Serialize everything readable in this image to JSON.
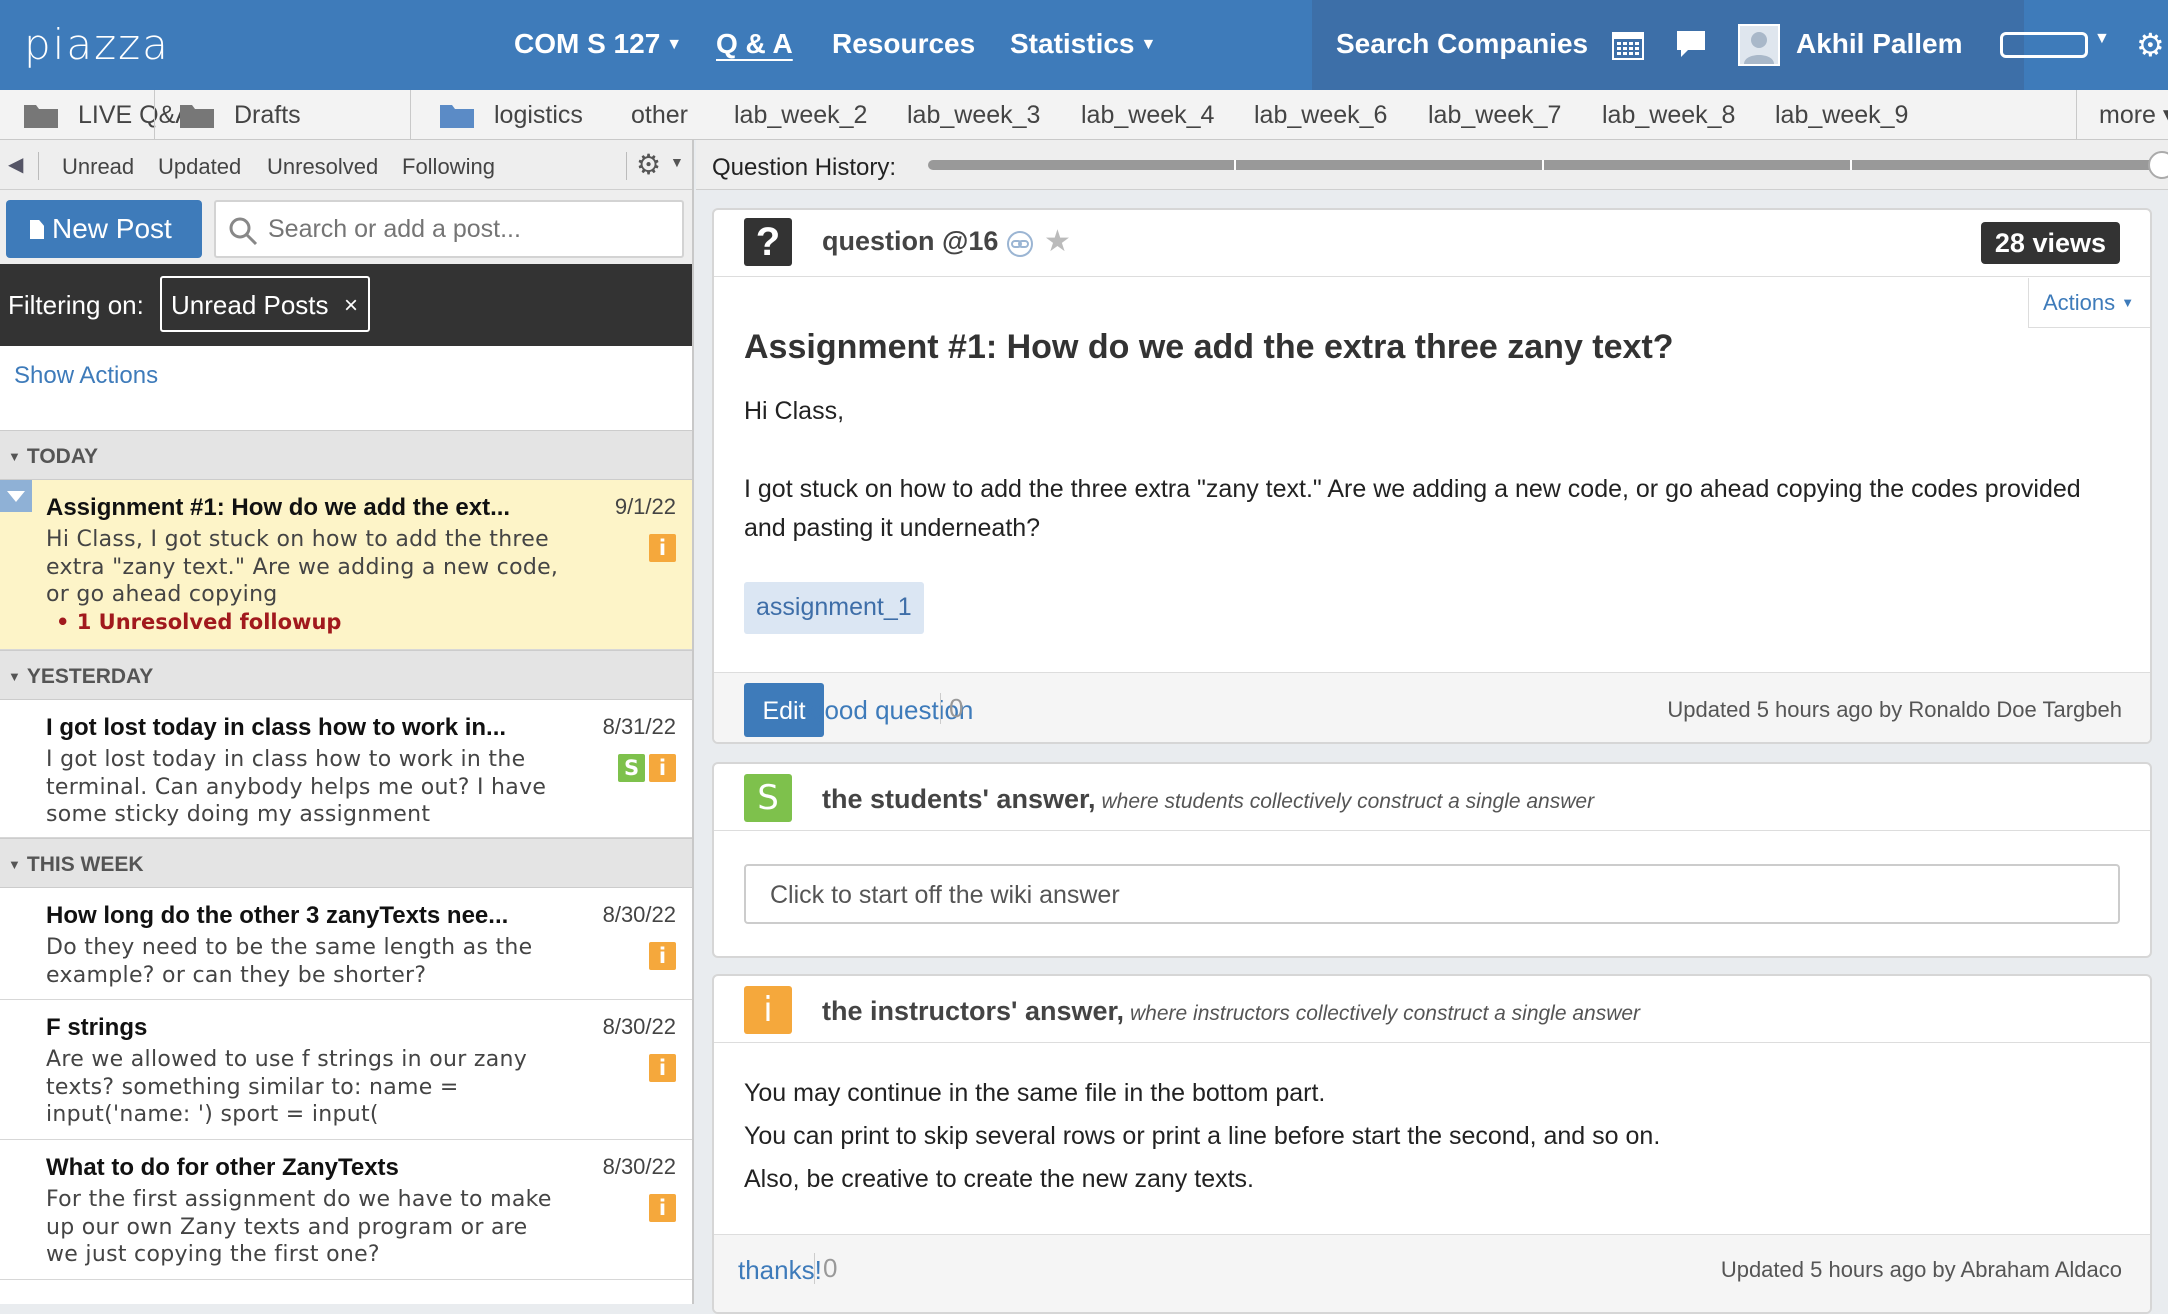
{
  "topbar": {
    "logo": "piazza",
    "course": "COM S 127",
    "qa": "Q & A",
    "resources": "Resources",
    "statistics": "Statistics",
    "search_companies": "Search Companies",
    "user_name": "Akhil Pallem",
    "colors": {
      "bar": "#3e7bba",
      "bar_dark": "#3d6fa8"
    }
  },
  "folders": {
    "items": [
      "LIVE Q&A",
      "Drafts",
      "logistics",
      "other",
      "lab_week_2",
      "lab_week_3",
      "lab_week_4",
      "lab_week_6",
      "lab_week_7",
      "lab_week_8",
      "lab_week_9"
    ],
    "more": "more"
  },
  "left": {
    "filters": [
      "Unread",
      "Updated",
      "Unresolved",
      "Following"
    ],
    "new_post": "New Post",
    "search_placeholder": "Search or add a post...",
    "filtering_label": "Filtering on:",
    "filter_chip": "Unread Posts",
    "filter_chip_close": "×",
    "show_actions": "Show Actions",
    "sections": [
      "TODAY",
      "YESTERDAY",
      "THIS WEEK"
    ],
    "posts": [
      {
        "title": "Assignment #1: How do we add the ext...",
        "date": "9/1/22",
        "snippet": "Hi Class, I got stuck on how to add the three extra \"zany text.\" Are we adding a new code, or go ahead copying",
        "followup": "1 Unresolved followup",
        "badges": [
          "i"
        ]
      },
      {
        "title": "I got lost today in class how to work in...",
        "date": "8/31/22",
        "snippet": "I got lost today in class how to work in the terminal. Can anybody helps me out? I have some sticky doing my assignment",
        "badges": [
          "S",
          "i"
        ]
      },
      {
        "title": "How long do the other 3 zanyTexts nee...",
        "date": "8/30/22",
        "snippet": "Do they need to be the same length as the example? or can they be shorter?",
        "badges": [
          "i"
        ]
      },
      {
        "title": "F strings",
        "date": "8/30/22",
        "snippet": "Are we allowed to use f strings in our zany texts? something similar to: name = input('name: ') sport = input(",
        "badges": [
          "i"
        ]
      },
      {
        "title": "What to do for other ZanyTexts",
        "date": "8/30/22",
        "snippet": "For the first assignment do we have to make up our own Zany texts and program or are we just copying the first one?",
        "badges": [
          "i"
        ]
      }
    ]
  },
  "history": {
    "label": "Question History:"
  },
  "question": {
    "icon": "?",
    "number": "question @16",
    "views": "28 views",
    "actions": "Actions",
    "title": "Assignment #1: How do we add the extra three zany text?",
    "greeting": "Hi Class,",
    "body": "I got stuck on how to add the three extra \"zany text.\" Are we adding a new code, or go ahead copying the codes provided and pasting it underneath?",
    "tag": "assignment_1",
    "edit": "Edit",
    "good_question": "good question",
    "good_count": "0",
    "updated": "Updated 5 hours ago by Ronaldo Doe Targbeh"
  },
  "students_answer": {
    "icon": "S",
    "title": "the students' answer,",
    "subtitle": "where students collectively construct a single answer",
    "placeholder": "Click to start off the wiki answer"
  },
  "instructors_answer": {
    "icon": "i",
    "title": "the instructors' answer,",
    "subtitle": "where instructors collectively construct a single answer",
    "lines": [
      "You may continue in the same file in the bottom part.",
      "You can print to skip several rows or print a line before start the second, and so on.",
      "Also, be creative to create the new zany texts."
    ],
    "thanks": "thanks!",
    "thanks_count": "0",
    "updated": "Updated 5 hours ago by Abraham Aldaco"
  }
}
